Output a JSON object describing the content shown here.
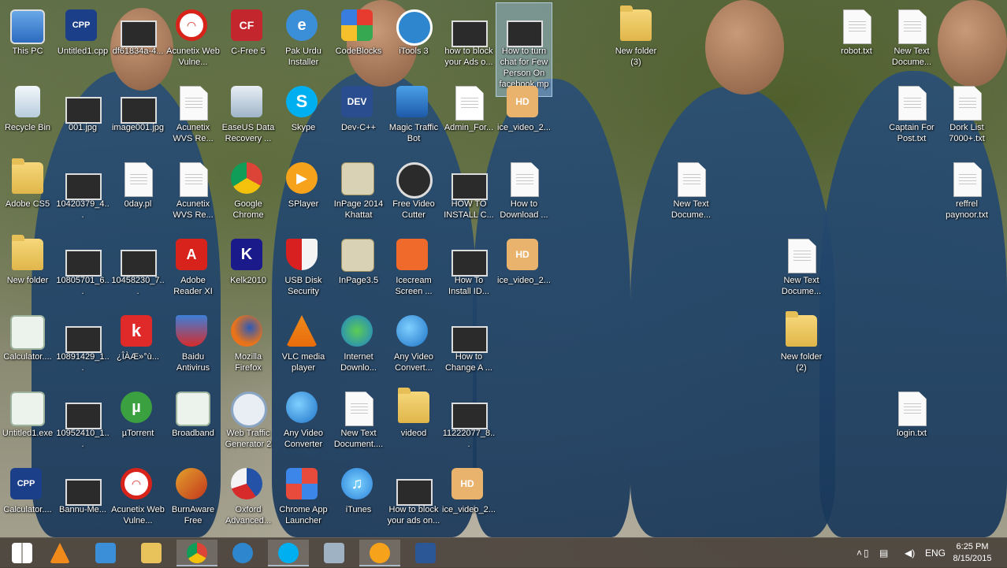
{
  "desktop_icons": [
    {
      "label": "This PC",
      "icon": "computer-icon"
    },
    {
      "label": "Untitled1.cpp",
      "icon": "cpp-file-icon"
    },
    {
      "label": "df61834a-4...",
      "icon": "image-file-icon"
    },
    {
      "label": "Acunetix Web Vulne...",
      "icon": "acunetix-icon"
    },
    {
      "label": "C-Free 5",
      "icon": "cfree-icon"
    },
    {
      "label": "Pak Urdu Installer",
      "icon": "ie-file-icon"
    },
    {
      "label": "CodeBlocks",
      "icon": "codeblocks-icon"
    },
    {
      "label": "iTools 3",
      "icon": "itools-icon"
    },
    {
      "label": "how to block your Ads o...",
      "icon": "video-file-icon"
    },
    {
      "label": "How to turn chat for Few Person On facebook.mp4",
      "icon": "video-file-icon"
    },
    {
      "label": "New folder (3)",
      "icon": "folder-icon"
    },
    {
      "label": "robot.txt",
      "icon": "text-file-icon"
    },
    {
      "label": "New Text Docume...",
      "icon": "text-file-icon"
    },
    {
      "label": "Recycle Bin",
      "icon": "recycle-bin-icon"
    },
    {
      "label": "001.jpg",
      "icon": "image-file-icon"
    },
    {
      "label": "image001.jpg",
      "icon": "image-file-icon"
    },
    {
      "label": "Acunetix WVS Re...",
      "icon": "document-icon"
    },
    {
      "label": "EaseUS Data Recovery ...",
      "icon": "easeus-icon"
    },
    {
      "label": "Skype",
      "icon": "skype-icon"
    },
    {
      "label": "Dev-C++",
      "icon": "devcpp-icon"
    },
    {
      "label": "Magic Traffic Bot",
      "icon": "traffic-bot-icon"
    },
    {
      "label": "Admin_For...",
      "icon": "pdf-file-icon"
    },
    {
      "label": "ice_video_2...",
      "icon": "hd-video-icon"
    },
    {
      "label": "Captain For Post.txt",
      "icon": "text-file-icon"
    },
    {
      "label": "Dork List 7000+.txt",
      "icon": "text-file-icon"
    },
    {
      "label": "Adobe CS5",
      "icon": "folder-icon"
    },
    {
      "label": "10420379_4...",
      "icon": "image-file-icon"
    },
    {
      "label": "0day.pl",
      "icon": "perl-file-icon"
    },
    {
      "label": "Acunetix WVS Re...",
      "icon": "document-icon"
    },
    {
      "label": "Google Chrome",
      "icon": "chrome-icon"
    },
    {
      "label": "SPlayer",
      "icon": "splayer-icon"
    },
    {
      "label": "InPage 2014 Khattat",
      "icon": "inpage-icon"
    },
    {
      "label": "Free Video Cutter",
      "icon": "video-cutter-icon"
    },
    {
      "label": "HOW TO INSTALL C...",
      "icon": "video-file-icon"
    },
    {
      "label": "How to Download ...",
      "icon": "word-file-icon"
    },
    {
      "label": "New Text Docume...",
      "icon": "text-file-icon"
    },
    {
      "label": "reffrel paynoor.txt",
      "icon": "text-file-icon"
    },
    {
      "label": "New folder",
      "icon": "folder-icon"
    },
    {
      "label": "10805701_6...",
      "icon": "image-file-icon"
    },
    {
      "label": "10458230_7...",
      "icon": "image-file-icon"
    },
    {
      "label": "Adobe Reader XI",
      "icon": "adobe-reader-icon"
    },
    {
      "label": "Kelk2010",
      "icon": "kelk-icon"
    },
    {
      "label": "USB Disk Security",
      "icon": "usb-security-icon"
    },
    {
      "label": "InPage3.5",
      "icon": "inpage-icon"
    },
    {
      "label": "Icecream Screen ...",
      "icon": "icecream-icon"
    },
    {
      "label": "How To Install ID...",
      "icon": "video-file-icon"
    },
    {
      "label": "ice_video_2...",
      "icon": "hd-video-icon"
    },
    {
      "label": "New Text Docume...",
      "icon": "text-file-icon"
    },
    {
      "label": "Calculator....",
      "icon": "calculator-icon"
    },
    {
      "label": "10891429_1...",
      "icon": "image-file-icon"
    },
    {
      "label": "¿ÎÀÆ»°ù...",
      "icon": "kingsoft-icon"
    },
    {
      "label": "Baidu Antivirus",
      "icon": "baidu-icon"
    },
    {
      "label": "Mozilla Firefox",
      "icon": "firefox-icon"
    },
    {
      "label": "VLC media player",
      "icon": "vlc-icon"
    },
    {
      "label": "Internet Downlo...",
      "icon": "idm-icon"
    },
    {
      "label": "Any Video Convert...",
      "icon": "any-video-icon"
    },
    {
      "label": "How to Change A ...",
      "icon": "video-file-icon"
    },
    {
      "label": "New folder (2)",
      "icon": "folder-icon"
    },
    {
      "label": "Untitled1.exe",
      "icon": "exe-file-icon"
    },
    {
      "label": "10952410_1...",
      "icon": "image-file-icon"
    },
    {
      "label": "µTorrent",
      "icon": "utorrent-icon"
    },
    {
      "label": "Broadband",
      "icon": "broadband-icon"
    },
    {
      "label": "Web Traffic Generator 2",
      "icon": "web-traffic-icon"
    },
    {
      "label": "Any Video Converter",
      "icon": "any-video-icon"
    },
    {
      "label": "New Text Document....",
      "icon": "text-file-icon"
    },
    {
      "label": "videod",
      "icon": "folder-icon"
    },
    {
      "label": "11222077_8...",
      "icon": "image-file-icon"
    },
    {
      "label": "login.txt",
      "icon": "text-file-icon"
    },
    {
      "label": "Calculator....",
      "icon": "cpp-file-icon"
    },
    {
      "label": "Bannu-Me...",
      "icon": "image-file-icon"
    },
    {
      "label": "Acunetix Web Vulne...",
      "icon": "acunetix-icon"
    },
    {
      "label": "BurnAware Free",
      "icon": "burnaware-icon"
    },
    {
      "label": "Oxford Advanced...",
      "icon": "oxford-icon"
    },
    {
      "label": "Chrome App Launcher",
      "icon": "app-launcher-icon"
    },
    {
      "label": "iTunes",
      "icon": "itunes-icon"
    },
    {
      "label": "How to block your ads on...",
      "icon": "video-file-icon"
    },
    {
      "label": "ice_video_2...",
      "icon": "hd-video-icon"
    }
  ],
  "taskbar": {
    "buttons": [
      {
        "name": "start-button",
        "icon": "windows-logo-icon"
      },
      {
        "name": "taskbar-vlc",
        "icon": "vlc-icon"
      },
      {
        "name": "taskbar-ie",
        "icon": "ie-icon"
      },
      {
        "name": "taskbar-explorer",
        "icon": "file-explorer-icon"
      },
      {
        "name": "taskbar-chrome",
        "icon": "chrome-icon"
      },
      {
        "name": "taskbar-itools",
        "icon": "itools-icon"
      },
      {
        "name": "taskbar-skype",
        "icon": "skype-icon"
      },
      {
        "name": "taskbar-app",
        "icon": "app-icon"
      },
      {
        "name": "taskbar-recorder",
        "icon": "record-icon"
      },
      {
        "name": "taskbar-word",
        "icon": "word-icon"
      }
    ],
    "tray": {
      "chevron": "˄",
      "language": "ENG"
    },
    "clock": {
      "time": "6:25 PM",
      "date": "8/15/2015"
    }
  },
  "colors": {
    "taskbar": "#463e37",
    "selection": "#a0c8f0"
  }
}
